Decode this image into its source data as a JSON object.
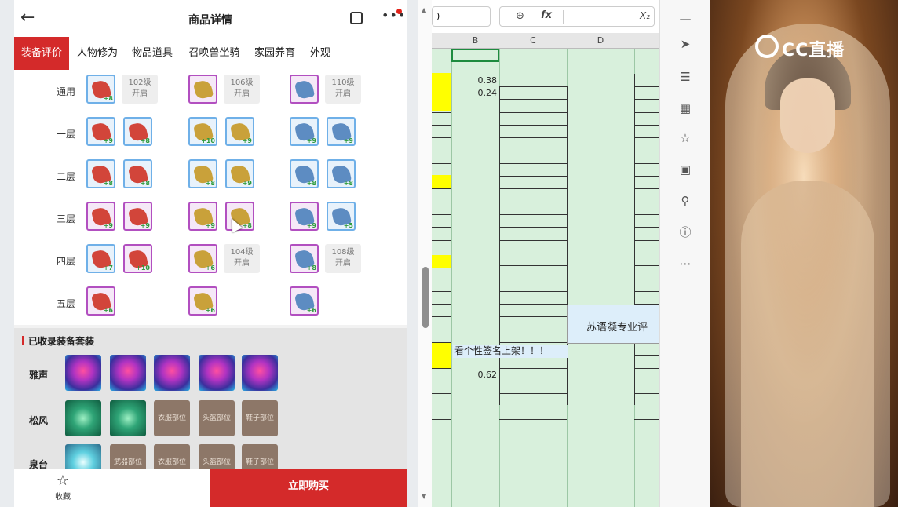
{
  "phone": {
    "title": "商品详情",
    "tabs": [
      "装备评价",
      "人物修为",
      "物品道具",
      "召唤兽坐骑",
      "家园养育",
      "外观"
    ],
    "rows": [
      {
        "label": "通用",
        "cells": [
          {
            "type": "icon",
            "color": "r",
            "frame": "b",
            "badge": "+8"
          },
          {
            "type": "lvl",
            "lines": [
              "102级",
              "开启"
            ]
          },
          {
            "type": "icon",
            "color": "g",
            "frame": "p",
            "badge": ""
          },
          {
            "type": "lvl",
            "lines": [
              "106级",
              "开启"
            ]
          },
          {
            "type": "icon",
            "color": "b",
            "frame": "p",
            "badge": ""
          },
          {
            "type": "lvl",
            "lines": [
              "110级",
              "开启"
            ]
          }
        ]
      },
      {
        "label": "一层",
        "cells": [
          {
            "type": "icon",
            "color": "r",
            "frame": "b",
            "badge": "+9"
          },
          {
            "type": "icon",
            "color": "r",
            "frame": "b",
            "badge": "+8"
          },
          {
            "type": "icon",
            "color": "g",
            "frame": "b",
            "badge": "+10"
          },
          {
            "type": "icon",
            "color": "g",
            "frame": "b",
            "badge": "+9"
          },
          {
            "type": "icon",
            "color": "b",
            "frame": "b",
            "badge": "+9"
          },
          {
            "type": "icon",
            "color": "b",
            "frame": "b",
            "badge": "+9"
          }
        ]
      },
      {
        "label": "二层",
        "cells": [
          {
            "type": "icon",
            "color": "r",
            "frame": "b",
            "badge": "+8"
          },
          {
            "type": "icon",
            "color": "r",
            "frame": "b",
            "badge": "+8"
          },
          {
            "type": "icon",
            "color": "g",
            "frame": "b",
            "badge": "+8"
          },
          {
            "type": "icon",
            "color": "g",
            "frame": "b",
            "badge": "+9"
          },
          {
            "type": "icon",
            "color": "b",
            "frame": "b",
            "badge": "+8"
          },
          {
            "type": "icon",
            "color": "b",
            "frame": "b",
            "badge": "+8"
          }
        ]
      },
      {
        "label": "三层",
        "cells": [
          {
            "type": "icon",
            "color": "r",
            "frame": "p",
            "badge": "+9"
          },
          {
            "type": "icon",
            "color": "r",
            "frame": "p",
            "badge": "+9"
          },
          {
            "type": "icon",
            "color": "g",
            "frame": "p",
            "badge": "+9"
          },
          {
            "type": "icon",
            "color": "g",
            "frame": "p",
            "badge": "+8"
          },
          {
            "type": "icon",
            "color": "b",
            "frame": "p",
            "badge": "+9"
          },
          {
            "type": "icon",
            "color": "b",
            "frame": "b",
            "badge": "+5"
          }
        ]
      },
      {
        "label": "四层",
        "cells": [
          {
            "type": "icon",
            "color": "r",
            "frame": "b",
            "badge": "+7"
          },
          {
            "type": "icon",
            "color": "r",
            "frame": "p",
            "badge": "+10"
          },
          {
            "type": "icon",
            "color": "g",
            "frame": "p",
            "badge": "+6"
          },
          {
            "type": "lvl",
            "lines": [
              "104级",
              "开启"
            ]
          },
          {
            "type": "icon",
            "color": "b",
            "frame": "p",
            "badge": "+8"
          },
          {
            "type": "lvl",
            "lines": [
              "108级",
              "开启"
            ]
          }
        ]
      },
      {
        "label": "五层",
        "cells": [
          {
            "type": "icon",
            "color": "r",
            "frame": "p",
            "badge": "+6"
          },
          {
            "type": "empty"
          },
          {
            "type": "icon",
            "color": "g",
            "frame": "p",
            "badge": "+6"
          },
          {
            "type": "empty"
          },
          {
            "type": "icon",
            "color": "b",
            "frame": "p",
            "badge": "+6"
          },
          {
            "type": "empty"
          }
        ]
      }
    ],
    "suits_title": "已收录装备套装",
    "suits": [
      {
        "label": "雅声",
        "cells": [
          {
            "kind": "purple",
            "text": ""
          },
          {
            "kind": "purple",
            "text": ""
          },
          {
            "kind": "purple",
            "text": ""
          },
          {
            "kind": "purple",
            "text": ""
          },
          {
            "kind": "purple",
            "text": ""
          }
        ]
      },
      {
        "label": "松风",
        "cells": [
          {
            "kind": "green",
            "text": ""
          },
          {
            "kind": "green",
            "text": ""
          },
          {
            "kind": "slot",
            "text": "衣服部位"
          },
          {
            "kind": "slot",
            "text": "头盔部位"
          },
          {
            "kind": "slot",
            "text": "鞋子部位"
          }
        ]
      },
      {
        "label": "泉台",
        "cells": [
          {
            "kind": "teal",
            "text": ""
          },
          {
            "kind": "slot",
            "text": "武器部位"
          },
          {
            "kind": "slot",
            "text": "衣服部位"
          },
          {
            "kind": "slot",
            "text": "头盔部位"
          },
          {
            "kind": "slot",
            "text": "鞋子部位"
          }
        ]
      }
    ],
    "fav_label": "收藏",
    "buy_label": "立即购买"
  },
  "sheet": {
    "namebox": ")",
    "columns": [
      "B",
      "C",
      "D"
    ],
    "values": [
      "0.38",
      "0.24",
      "0.62"
    ],
    "blue_text": "苏语凝专业评",
    "sig_text": "看个性签名上架！！！"
  },
  "video": {
    "logo_text": "CC直播"
  }
}
